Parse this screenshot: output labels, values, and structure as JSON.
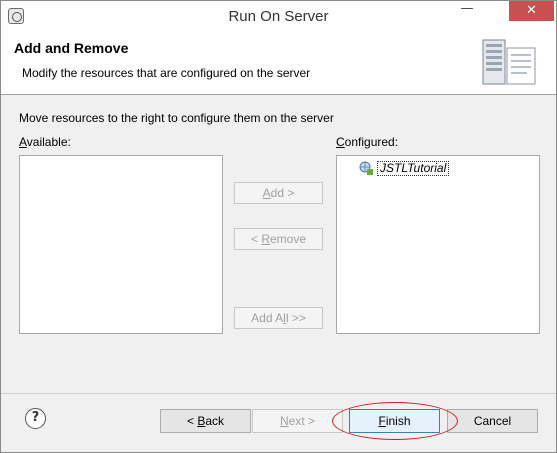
{
  "window": {
    "title": "Run On Server",
    "minimize_glyph": "—",
    "close_glyph": "✕"
  },
  "header": {
    "title": "Add and Remove",
    "description": "Modify the resources that are configured on the server",
    "banner_icon": "server-wizard-icon"
  },
  "body": {
    "instruction": "Move resources to the right to configure them on the server",
    "available": {
      "label_first": "A",
      "label_rest": "vailable:",
      "items": []
    },
    "configured": {
      "label_first": "C",
      "label_rest": "onfigured:",
      "items": [
        {
          "label": "JSTLTutorial",
          "icon": "web-project-icon"
        }
      ]
    },
    "buttons": {
      "add": {
        "ul": "A",
        "rest": "dd >",
        "enabled": false
      },
      "remove": {
        "pre": "< ",
        "ul": "R",
        "rest": "emove",
        "enabled": false
      },
      "add_all": {
        "pre": "Add A",
        "ul": "l",
        "rest": "l >>",
        "enabled": false
      }
    }
  },
  "footer": {
    "help_glyph": "?",
    "back": {
      "pre": "< ",
      "ul": "B",
      "rest": "ack",
      "enabled": true
    },
    "next": {
      "ul": "N",
      "rest": "ext >",
      "enabled": false
    },
    "finish": {
      "ul": "F",
      "rest": "inish",
      "enabled": true,
      "highlighted": true
    },
    "cancel": {
      "label": "Cancel",
      "enabled": true
    }
  },
  "colors": {
    "close_button": "#c75050",
    "highlight": "#cc1f1f",
    "default_button_border": "#3c7fb1"
  }
}
